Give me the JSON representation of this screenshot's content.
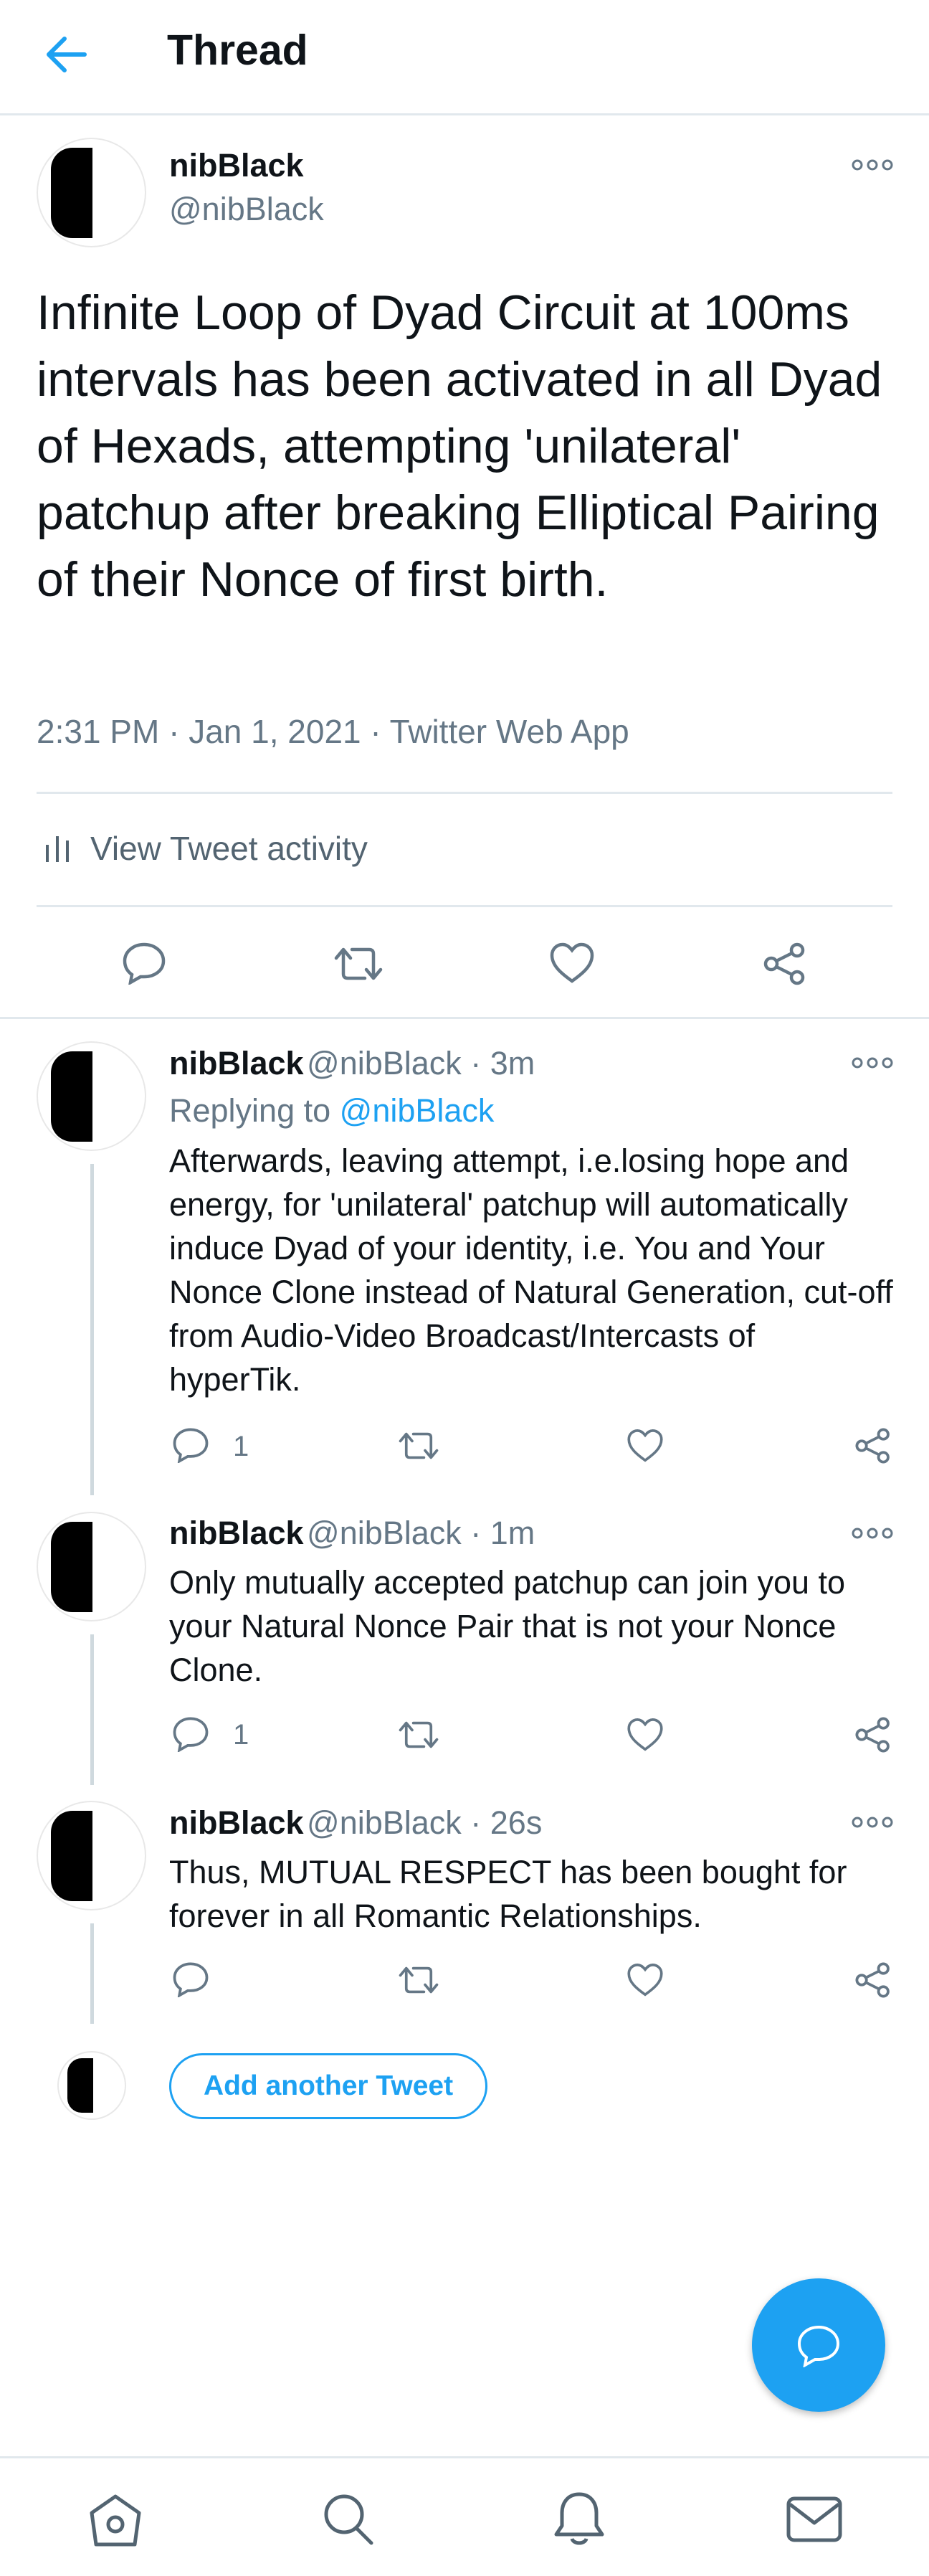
{
  "header": {
    "title": "Thread"
  },
  "main_tweet": {
    "name": "nibBlack",
    "handle": "@nibBlack",
    "text": "Infinite Loop of Dyad Circuit at 100ms intervals has been activated in all Dyad of Hexads, attempting 'unilateral' patchup after breaking Elliptical Pairing of their Nonce of first birth.",
    "meta": "2:31 PM · Jan 1, 2021 · Twitter Web App",
    "activity_label": "View Tweet activity"
  },
  "replies": [
    {
      "name": "nibBlack",
      "handle_time": "@nibBlack · 3m",
      "replying_prefix": "Replying to ",
      "replying_to": "@nibBlack",
      "text": "Afterwards, leaving attempt, i.e.losing hope and energy, for 'unilateral' patchup will automatically induce Dyad of your identity, i.e. You and Your Nonce Clone instead of Natural Generation, cut-off from Audio-Video Broadcast/Intercasts of hyperTik.",
      "reply_count": "1"
    },
    {
      "name": "nibBlack",
      "handle_time": "@nibBlack · 1m",
      "text": "Only mutually accepted patchup can join you to your Natural Nonce Pair that is not your Nonce Clone.",
      "reply_count": "1"
    },
    {
      "name": "nibBlack",
      "handle_time": "@nibBlack · 26s",
      "text": "Thus, MUTUAL RESPECT has been bought for forever in all Romantic Relationships."
    }
  ],
  "compose": {
    "add_label": "Add another Tweet"
  },
  "colors": {
    "accent": "#1da1f2",
    "muted": "#657786",
    "divider": "#e1e8ed"
  },
  "icons": [
    "back-arrow-icon",
    "more-icon",
    "activity-icon",
    "reply-icon",
    "retweet-icon",
    "like-icon",
    "share-icon",
    "compose-icon",
    "home-icon",
    "search-icon",
    "notifications-icon",
    "messages-icon"
  ]
}
